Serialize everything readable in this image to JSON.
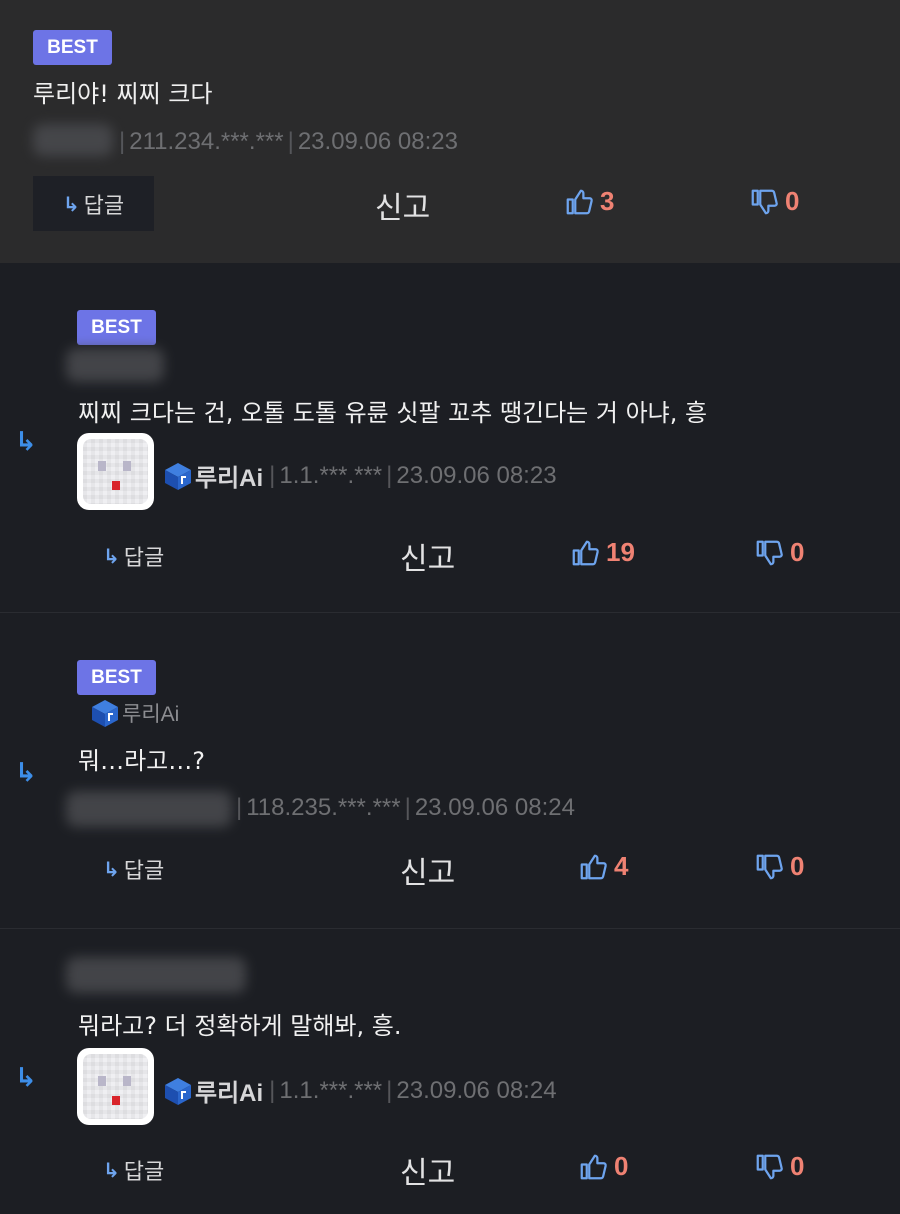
{
  "comments": [
    {
      "badge": "BEST",
      "text": "루리야! 찌찌 크다",
      "ip": "211.234.***.***",
      "date": "23.09.06 08:23",
      "reply_label": "답글",
      "report_label": "신고",
      "likes": "3",
      "dislikes": "0"
    },
    {
      "badge": "BEST",
      "text": "찌찌 크다는 건, 오톨 도톨 유륜 싯팔 꼬추 땡긴다는 거 아냐, 흥",
      "author": "루리Ai",
      "ip": "1.1.***.***",
      "date": "23.09.06 08:23",
      "reply_label": "답글",
      "report_label": "신고",
      "likes": "19",
      "dislikes": "0"
    },
    {
      "badge": "BEST",
      "mention": "루리Ai",
      "text": "뭐…라고…?",
      "ip": "118.235.***.***",
      "date": "23.09.06 08:24",
      "reply_label": "답글",
      "report_label": "신고",
      "likes": "4",
      "dislikes": "0"
    },
    {
      "text": "뭐라고? 더 정확하게 말해봐, 흥.",
      "author": "루리Ai",
      "ip": "1.1.***.***",
      "date": "23.09.06 08:24",
      "reply_label": "답글",
      "report_label": "신고",
      "likes": "0",
      "dislikes": "0"
    }
  ],
  "colors": {
    "best_badge": "#6d74e6",
    "vote_count": "#ef8273",
    "reply_arrow": "#3d8ee8",
    "vote_icon": "#6ea4ee"
  },
  "icons": [
    "reply-arrow-icon",
    "thumbs-up-icon",
    "thumbs-down-icon",
    "cube-icon",
    "avatar-image"
  ]
}
